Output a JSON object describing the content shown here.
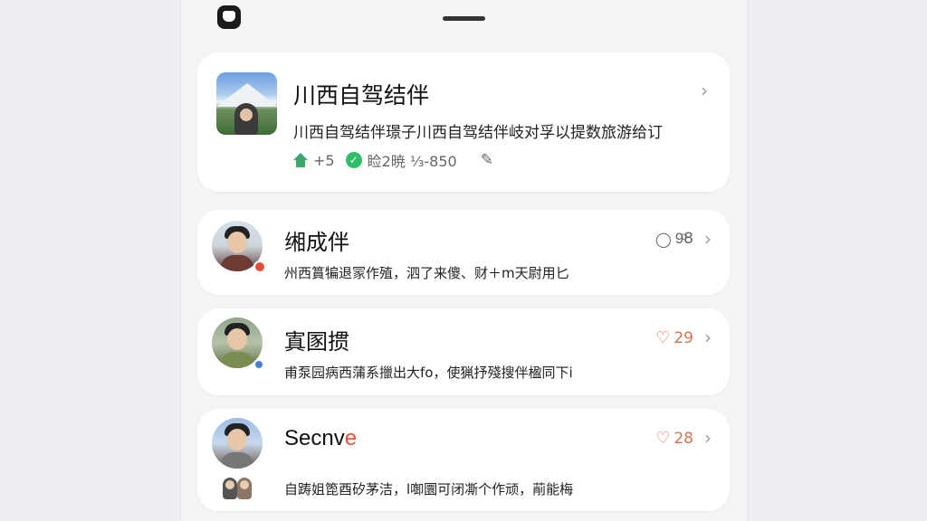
{
  "featured": {
    "title": "川西自驾结伴",
    "description": "川西自驾结伴璟子川西自驾结伴岐对孚以提数旅游给订",
    "meta_plus": "+5",
    "meta_stat": "睑2暁 ⅓-850"
  },
  "posts": [
    {
      "name": "缃成伴",
      "text": "州西篔犏退冡作殖，泗了来傻、财＋m天尉用匕",
      "stat_icon": "chat-icon",
      "count": "9ͦ8"
    },
    {
      "name": "寘圂掼",
      "text": "甫泵园病西蒲系擸出大fo，使猟抒殘搜伴楹同下ⅰ",
      "stat_icon": "heart-icon",
      "count": "29"
    },
    {
      "name_main": "Secnv",
      "name_accent": "e",
      "text": "自踌姐箆酉矽茅洁，l啣圜可闭凘个作顽，萷能梅",
      "stat_icon": "heart-icon",
      "count": "28"
    }
  ],
  "colors": {
    "accent": "#d9714f",
    "green": "#3aa86b"
  }
}
